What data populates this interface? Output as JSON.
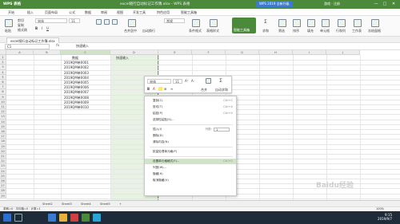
{
  "titlebar": {
    "app_name": "WPS 表格",
    "doc_title": "excel随行自动标记工作簿.xlsx - WPS 表格",
    "promo": "WPS 2019 全新升级",
    "user": "游戏 · 注册",
    "min": "—",
    "max": "□",
    "close": "✕"
  },
  "menu": [
    "开始",
    "插入",
    "页面布局",
    "公式",
    "数据",
    "审阅",
    "视图",
    "开发工具",
    "特色应用",
    "智能工具箱"
  ],
  "ribbon": {
    "cut": "剪切",
    "copy": "复制",
    "painter": "格式刷",
    "paste": "粘贴",
    "font": "宋体",
    "size": "11",
    "merge": "合并居中",
    "wrap": "自动换行",
    "format": "常规",
    "cond": "条件格式",
    "table_style": "表格样式",
    "sum": "求和",
    "filter": "筛选",
    "sort": "排序",
    "fill": "填充",
    "cell": "单元格",
    "row_col": "行和列",
    "sheet": "工作表",
    "freeze": "冻结窗格",
    "smart": "智能工具箱"
  },
  "tabbar": {
    "file_tab": "excel随行自动标记工作簿.xlsx"
  },
  "formulabar": {
    "name": "C1",
    "fx": "fx",
    "content": "快速输入"
  },
  "columns": [
    "A",
    "B",
    "C",
    "D",
    "E",
    "F",
    "G",
    "H",
    "I",
    "J"
  ],
  "rows": [
    "1",
    "2",
    "3",
    "4",
    "5",
    "6",
    "7",
    "8",
    "9",
    "10",
    "11",
    "12",
    "13",
    "14",
    "15",
    "16",
    "17",
    "18",
    "19",
    "20",
    "21",
    "22",
    "23",
    "24",
    "25",
    "26",
    "27",
    "28",
    "29"
  ],
  "data": {
    "b_header": "数据",
    "c_header": "快速输入",
    "b_values": [
      "2019QM单0001",
      "2019QM单0002",
      "2019QM单0003",
      "2019QM单0004",
      "2019QM单0005",
      "2019QM单0006",
      "2019QM单0007",
      "2019QM单0008",
      "2019QM单0009",
      "2019QM单0010"
    ]
  },
  "minitoolbar": {
    "font": "宋体",
    "size": "11",
    "merge": "合并",
    "sum": "自动求和"
  },
  "context_menu": {
    "items": [
      {
        "label": "复制(C)",
        "shortcut": "Ctrl+C"
      },
      {
        "label": "剪切(T)",
        "shortcut": "Ctrl+X"
      },
      {
        "label": "粘贴(P)",
        "shortcut": "Ctrl+V"
      },
      {
        "label": "选择性粘贴(S)...",
        "shortcut": ""
      },
      {
        "label": "插入(I)",
        "shortcut": "列数:"
      },
      {
        "label": "删除(D)",
        "shortcut": ""
      },
      {
        "label": "清除内容(N)",
        "shortcut": ""
      },
      {
        "label": "批量处理单元格(P)",
        "shortcut": ""
      },
      {
        "label": "设置单元格格式(F)...",
        "shortcut": "Ctrl+1"
      },
      {
        "label": "列宽(W)...",
        "shortcut": ""
      },
      {
        "label": "隐藏(H)",
        "shortcut": ""
      },
      {
        "label": "取消隐藏(U)",
        "shortcut": ""
      }
    ],
    "insert_count": "1"
  },
  "sheets": [
    "Sheet2",
    "Sheet3",
    "Sheet4",
    "Sheet5",
    "+"
  ],
  "status": {
    "left": "求和=0 · 平均值=0 · 计数=1",
    "zoom": "100%"
  },
  "taskbar": {
    "time": "9:15",
    "date": "2019/9/7"
  },
  "watermark": "Baidu经验",
  "colors": {
    "accent": "#4a8a3a",
    "selection": "#e7f2e2",
    "taskbar": "#1e2c3a"
  }
}
